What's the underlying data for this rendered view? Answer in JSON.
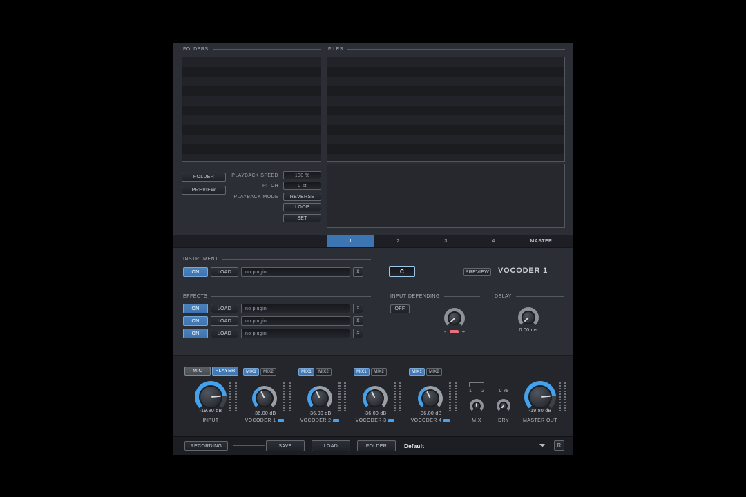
{
  "browser": {
    "folders_label": "FOLDERS",
    "files_label": "FILES",
    "folder_button": "FOLDER",
    "preview_button": "PREVIEW",
    "playback_speed_label": "PLAYBACK SPEED",
    "playback_speed_value": "100 %",
    "pitch_label": "PITCH",
    "pitch_value": "0 st",
    "playback_mode_label": "PLAYBACK MODE",
    "reverse_button": "REVERSE",
    "loop_button": "LOOP",
    "set_button": "SET"
  },
  "tabs": {
    "tab1": "1",
    "tab2": "2",
    "tab3": "3",
    "tab4": "4",
    "master": "MASTER",
    "active": "1"
  },
  "instrument": {
    "section_label": "INSTRUMENT",
    "on_button": "ON",
    "load_button": "LOAD",
    "plugin_value": "no plugin",
    "remove_button": "X",
    "key_value": "C",
    "preview_button": "PREVIEW",
    "title": "VOCODER 1"
  },
  "effects": {
    "section_label": "EFFECTS",
    "rows": [
      {
        "on": "ON",
        "load": "LOAD",
        "plugin": "no plugin",
        "remove": "X"
      },
      {
        "on": "ON",
        "load": "LOAD",
        "plugin": "no plugin",
        "remove": "X"
      },
      {
        "on": "ON",
        "load": "LOAD",
        "plugin": "no plugin",
        "remove": "X"
      }
    ]
  },
  "input_depending": {
    "section_label": "INPUT DEPENDING",
    "off_button": "OFF",
    "minus_label": "-",
    "plus_label": "+"
  },
  "delay": {
    "section_label": "DELAY",
    "time_value": "0.00 ms"
  },
  "mixer": {
    "mic_button": "MIC",
    "player_button": "PLAYER",
    "input": {
      "value": "-19.80 dB",
      "label": "INPUT"
    },
    "vocoders": [
      {
        "mix1": "MIX1",
        "mix2": "MIX2",
        "value": "-36.00 dB",
        "label": "VOCODER 1"
      },
      {
        "mix1": "MIX1",
        "mix2": "MIX2",
        "value": "-36.00 dB",
        "label": "VOCODER 2"
      },
      {
        "mix1": "MIX1",
        "mix2": "MIX2",
        "value": "-36.00 dB",
        "label": "VOCODER 3"
      },
      {
        "mix1": "MIX1",
        "mix2": "MIX2",
        "value": "-36.00 dB",
        "label": "VOCODER 4"
      }
    ],
    "mix": {
      "tick1": "1",
      "tick2": "2",
      "label": "MIX"
    },
    "dry": {
      "value": "0 %",
      "label": "DRY"
    },
    "master": {
      "value": "-19.80 dB",
      "label": "MASTER OUT"
    }
  },
  "footer": {
    "recording_button": "RECORDING",
    "save_button": "SAVE",
    "load_button": "LOAD",
    "folder_button": "FOLDER",
    "preset_value": "Default",
    "r_button": "R"
  },
  "colors": {
    "accent_blue": "#3d74b2",
    "ring_blue": "#45a1ec",
    "indicator_pink": "#e8717c"
  }
}
